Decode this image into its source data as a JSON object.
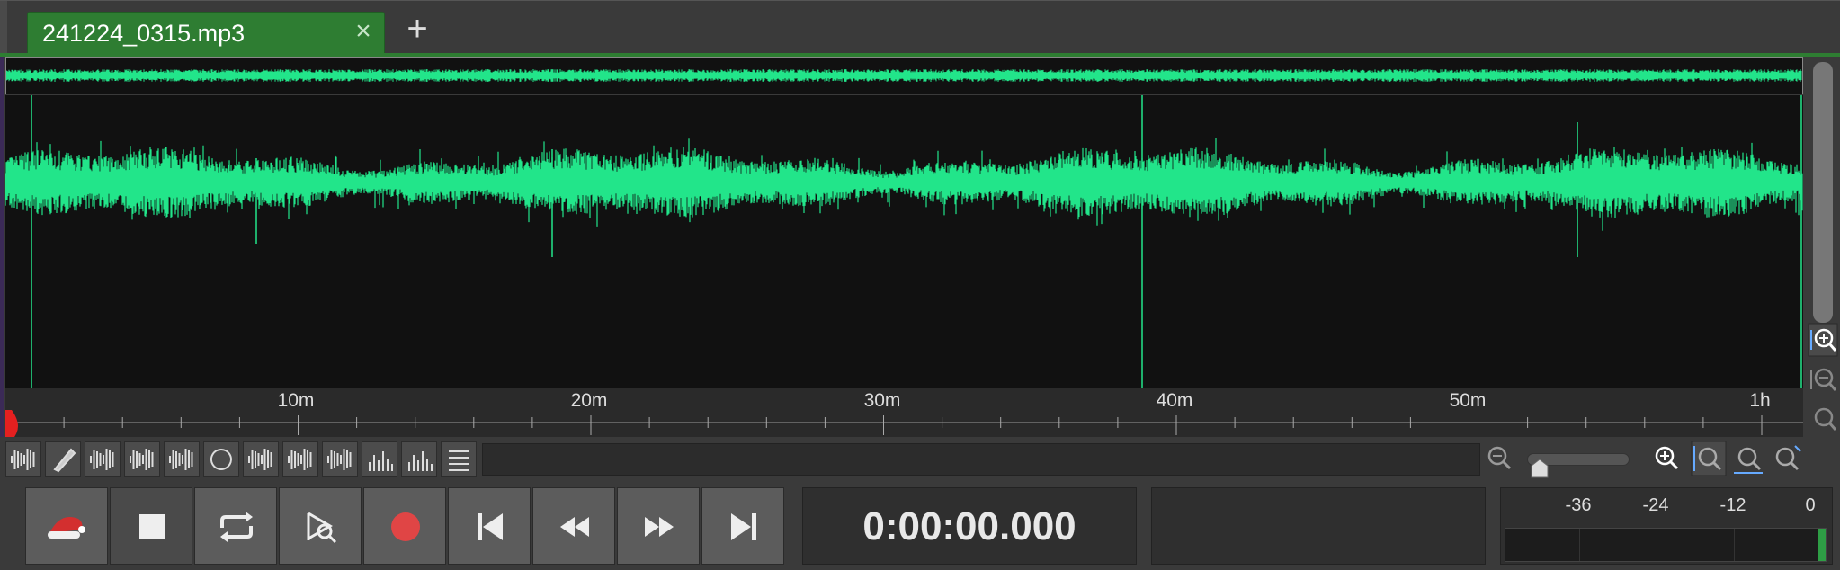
{
  "tab": {
    "filename": "241224_0315.mp3",
    "close_glyph": "×",
    "add_glyph": "+"
  },
  "ruler": {
    "labels": [
      "10m",
      "20m",
      "30m",
      "40m",
      "50m",
      "1h"
    ]
  },
  "toolbar": {
    "tools": [
      "waveform-view-icon",
      "pencil-icon",
      "channel-merge-icon",
      "channel-right-icon",
      "channel-lr-icon",
      "lr-balance-icon",
      "no-waveform-icon",
      "waveform-small-icon",
      "waveform-edit-icon",
      "spectrum-bars-icon",
      "spectrum-fine-icon",
      "list-icon"
    ],
    "zoom_level_fraction": 0.05
  },
  "transport": {
    "time_display": "0:00:00.000",
    "buttons": [
      "santa-hat-icon",
      "stop-icon",
      "loop-icon",
      "scrub-icon",
      "record-icon",
      "skip-to-start-icon",
      "rewind-icon",
      "fast-forward-icon",
      "skip-to-end-icon"
    ]
  },
  "meter": {
    "labels": [
      "-36",
      "-24",
      "-12",
      "0"
    ]
  },
  "colors": {
    "wave": "#22e58a",
    "tab_green": "#2e7d32",
    "record_red": "#e04545"
  }
}
